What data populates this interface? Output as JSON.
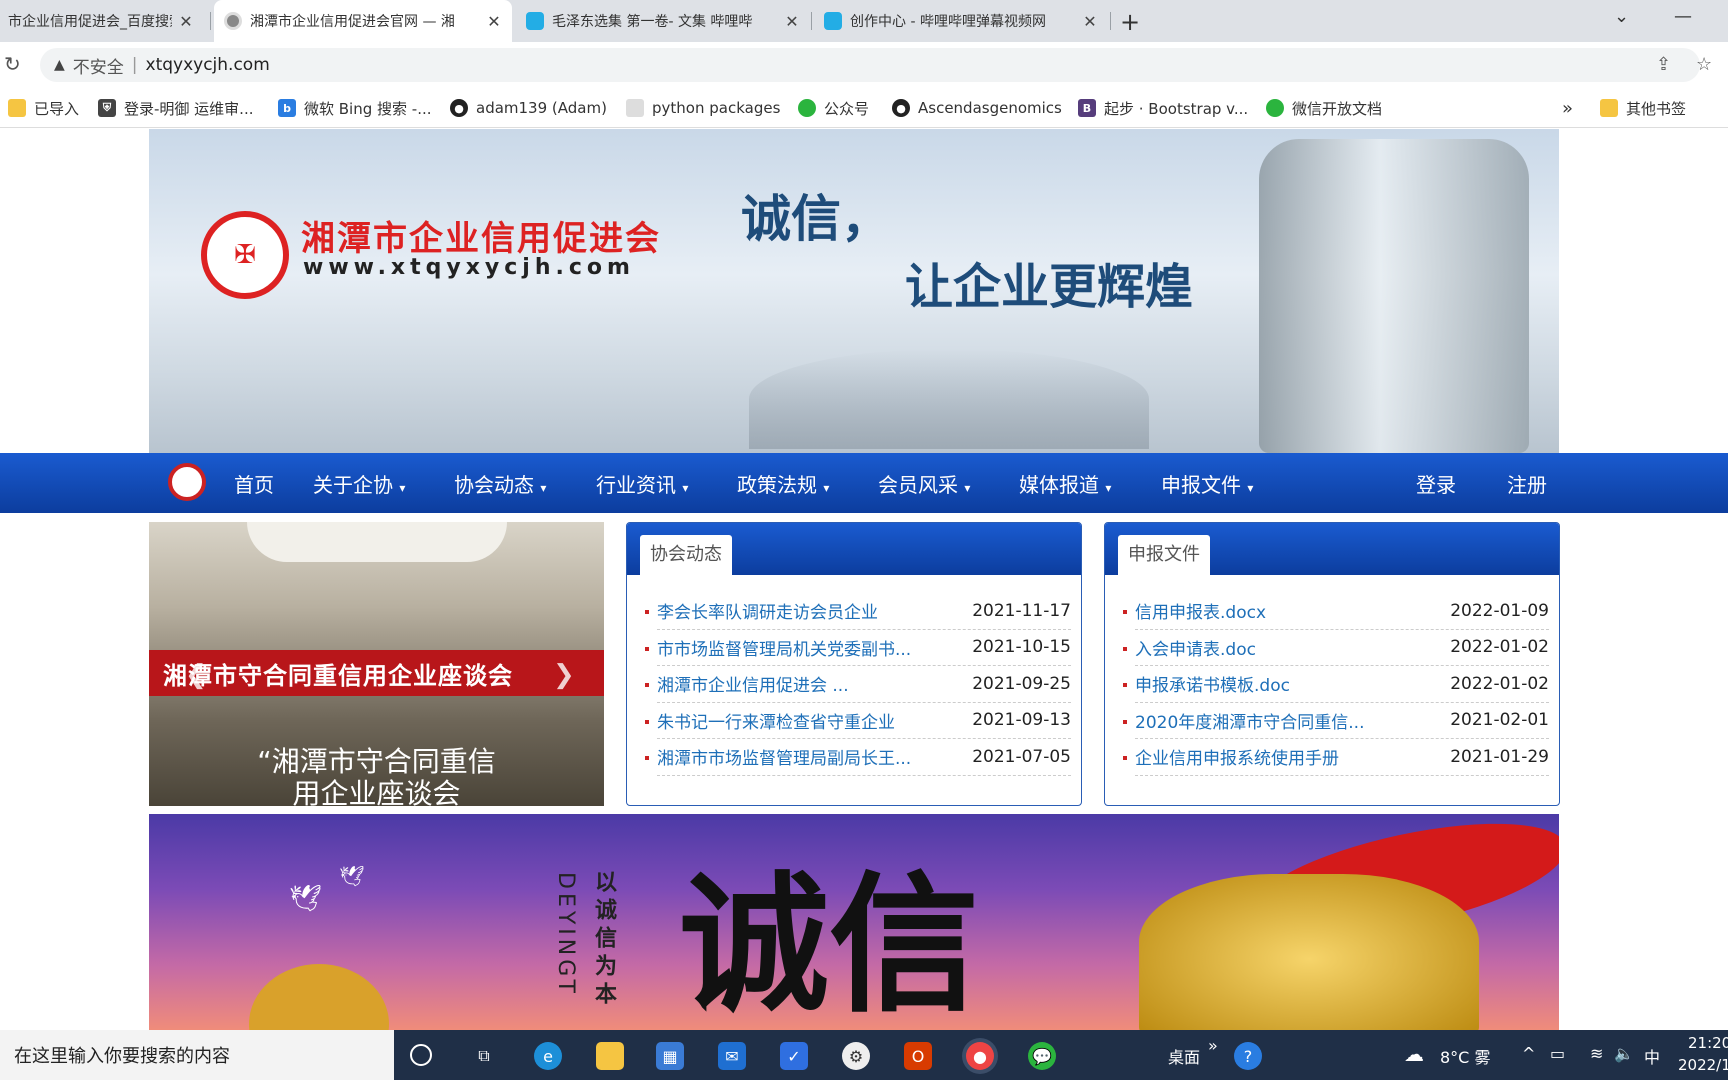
{
  "browser": {
    "tabs": [
      {
        "title": "市企业信用促进会_百度搜索",
        "close": "✕",
        "active": false
      },
      {
        "title": "湘潭市企业信用促进会官网 — 湘",
        "close": "✕",
        "active": true
      },
      {
        "title": "毛泽东选集 第一卷- 文集 哔哩哔",
        "close": "✕",
        "active": false
      },
      {
        "title": "创作中心 - 哔哩哔哩弹幕视频网",
        "close": "✕",
        "active": false
      }
    ],
    "new_tab": "+",
    "address": {
      "security_label": "不安全",
      "url": "xtqyxycjh.com"
    },
    "bookmarks": [
      {
        "label": "已导入",
        "icon": "folder-icon"
      },
      {
        "label": "登录-明御 运维审...",
        "icon": "shield-icon"
      },
      {
        "label": "微软 Bing 搜索 -...",
        "icon": "bing-icon"
      },
      {
        "label": "adam139 (Adam)",
        "icon": "github-icon"
      },
      {
        "label": "python packages",
        "icon": "box-icon"
      },
      {
        "label": "公众号",
        "icon": "wechat-icon"
      },
      {
        "label": "Ascendasgenomics",
        "icon": "github-icon"
      },
      {
        "label": "起步 · Bootstrap v...",
        "icon": "bootstrap-icon"
      },
      {
        "label": "微信开放文档",
        "icon": "wechat-icon"
      }
    ],
    "bookmarks_more": "»",
    "other_bookmarks": "其他书签"
  },
  "banner": {
    "org_name": "湘潭市企业信用促进会",
    "org_url": "www.xtqyxycjh.com",
    "slogan_line1": "诚信，",
    "slogan_line2": "让企业更辉煌"
  },
  "nav": {
    "items": [
      "首页",
      "关于企协",
      "协会动态",
      "行业资讯",
      "政策法规",
      "会员风采",
      "媒体报道",
      "申报文件"
    ],
    "login": "登录",
    "register": "注册"
  },
  "slider": {
    "band_text": "湘潭市守合同重信用企业座谈会",
    "caption_line1": "“湘潭市守合同重信",
    "caption_line2": "用企业座谈会"
  },
  "news_panel": {
    "tab": "协会动态",
    "items": [
      {
        "title": "李会长率队调研走访会员企业",
        "date": "2021-11-17"
      },
      {
        "title": "市市场监督管理局机关党委副书...",
        "date": "2021-10-15"
      },
      {
        "title": "湘潭市企业信用促进会 ...",
        "date": "2021-09-25"
      },
      {
        "title": "朱书记一行来潭检查省守重企业",
        "date": "2021-09-13"
      },
      {
        "title": "湘潭市市场监督管理局副局长王...",
        "date": "2021-07-05"
      }
    ]
  },
  "files_panel": {
    "tab": "申报文件",
    "items": [
      {
        "title": "信用申报表.docx",
        "date": "2022-01-09"
      },
      {
        "title": "入会申请表.doc",
        "date": "2022-01-02"
      },
      {
        "title": "申报承诺书模板.doc",
        "date": "2022-01-02"
      },
      {
        "title": "2020年度湘潭市守合同重信...",
        "date": "2021-02-01"
      },
      {
        "title": "企业信用申报系统使用手册",
        "date": "2021-01-29"
      }
    ]
  },
  "bottom_banner": {
    "vertical_text": "以诚信为本",
    "vertical_en": "DEYINGT",
    "big_char": "诚信"
  },
  "taskbar": {
    "search_placeholder": "在这里输入你要搜索的内容",
    "desktop_label": "桌面",
    "weather": "8°C 雾",
    "ime": "中",
    "time": "21:20",
    "date": "2022/1"
  },
  "colors": {
    "nav_blue": "#1a5bd0",
    "brand_red": "#d22222",
    "link_blue": "#1e6fb8"
  }
}
